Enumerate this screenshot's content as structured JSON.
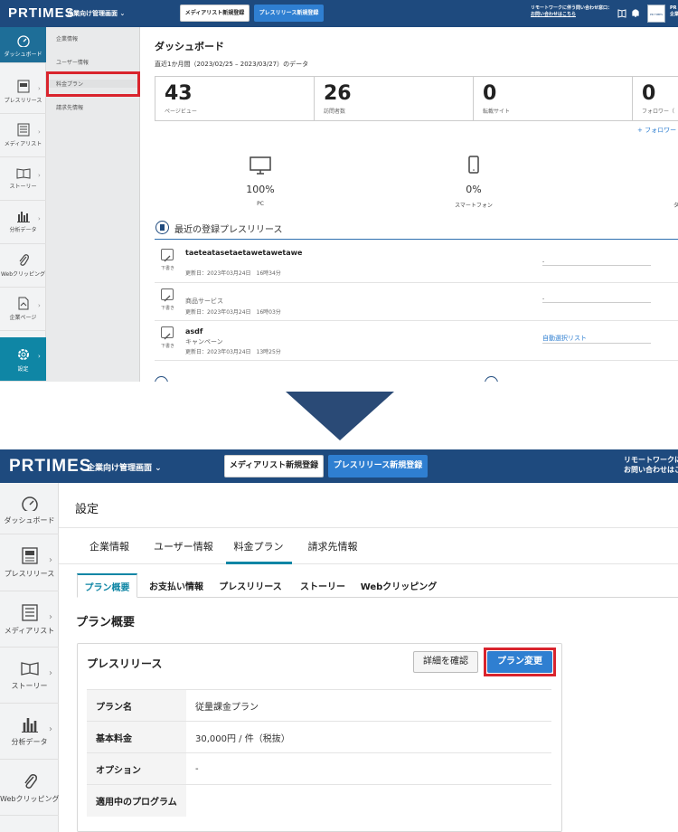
{
  "header": {
    "logo": "PRTIMES",
    "admin_link": "企業向け管理画面",
    "media_list_button": "メディアリスト新規登録",
    "press_release_button": "プレスリリース新規登録",
    "remote_line1": "リモートワークに伴う問い合わせ窓口：",
    "remote_line2": "お問い合わせはこちら",
    "remote_line1_short": "リモートワークに",
    "remote_line2_short": "お問い合わせはこ",
    "top_right_label": "PR",
    "top_right_label2": "企業"
  },
  "sidebar": {
    "items": [
      {
        "label": "ダッシュボード",
        "icon": "gauge-icon"
      },
      {
        "label": "プレスリリース",
        "icon": "document-icon"
      },
      {
        "label": "メディアリスト",
        "icon": "list-icon"
      },
      {
        "label": "ストーリー",
        "icon": "book-icon"
      },
      {
        "label": "分析データ",
        "icon": "bar-chart-icon"
      },
      {
        "label": "Webクリッピング",
        "icon": "paperclip-icon"
      },
      {
        "label": "企業ページ",
        "icon": "page-icon"
      },
      {
        "label": "設定",
        "icon": "gear-icon"
      }
    ]
  },
  "submenu": {
    "items": [
      "企業情報",
      "ユーザー情報",
      "料金プラン",
      "請求先情報"
    ]
  },
  "dashboard": {
    "title": "ダッシュボード",
    "period": "直近1か月間（2023/02/25 – 2023/03/27）のデータ",
    "stats": [
      {
        "value": "43",
        "label": "ページビュー"
      },
      {
        "value": "26",
        "label": "訪問者数"
      },
      {
        "value": "0",
        "label": "転載サイト"
      },
      {
        "value": "0",
        "label": "フォロワー（"
      }
    ],
    "follow_link": "+ フォロワー",
    "devices": [
      {
        "percent": "100%",
        "label": "PC",
        "icon": "monitor-icon"
      },
      {
        "percent": "0%",
        "label": "スマートフォン",
        "icon": "smartphone-icon"
      }
    ],
    "device_cut_label": "タ",
    "recent_title": "最近の登録プレスリリース",
    "releases": [
      {
        "draft": "下書き",
        "title": "taeteatasetaetawetawetawe",
        "category": "",
        "updated": "更新日：2023年03月24日　16時34分",
        "right": "-"
      },
      {
        "draft": "下書き",
        "title": "",
        "category": "商品サービス",
        "updated": "更新日：2023年03月24日　16時03分",
        "right": "-"
      },
      {
        "draft": "下書き",
        "title": "asdf",
        "category": "キャンペーン",
        "updated": "更新日：2023年03月24日　13時25分",
        "right": "自動選択リスト"
      }
    ]
  },
  "settings": {
    "title": "設定",
    "tabs": [
      "企業情報",
      "ユーザー情報",
      "料金プラン",
      "請求先情報"
    ],
    "active_tab": "料金プラン",
    "subtabs": [
      "プラン概要",
      "お支払い情報",
      "プレスリリース",
      "ストーリー",
      "Webクリッピング"
    ],
    "active_subtab": "プラン概要",
    "section_title": "プラン概要",
    "card_title": "プレスリリース",
    "detail_button": "詳細を確認",
    "change_button": "プラン変更",
    "rows": [
      {
        "key": "プラン名",
        "value": "従量課金プラン"
      },
      {
        "key": "基本料金",
        "value": "30,000円 / 件（税抜）"
      },
      {
        "key": "オプション",
        "value": "-"
      },
      {
        "key": "適用中のプログラム",
        "value": ""
      }
    ]
  },
  "colors": {
    "header": "#1e4a7e",
    "accent": "#0f86a5",
    "button_blue": "#2f7fd1",
    "highlight": "#d9242d",
    "arrow": "#2a4a76"
  }
}
